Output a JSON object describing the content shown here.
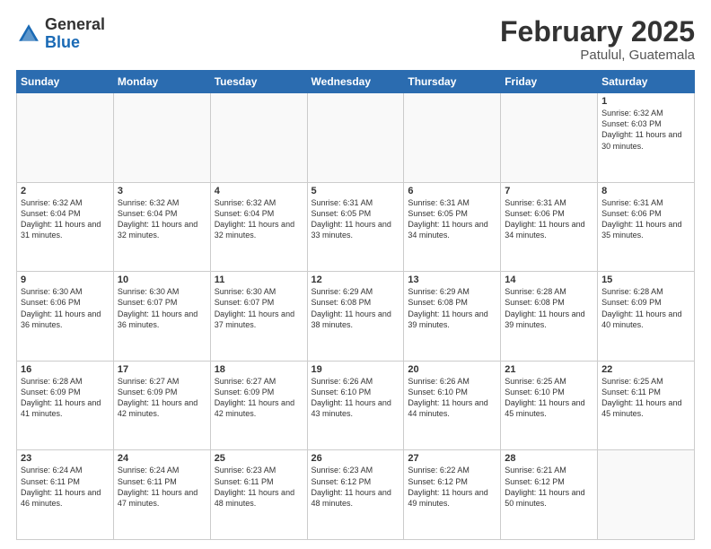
{
  "header": {
    "logo_general": "General",
    "logo_blue": "Blue",
    "month_title": "February 2025",
    "location": "Patulul, Guatemala"
  },
  "days_of_week": [
    "Sunday",
    "Monday",
    "Tuesday",
    "Wednesday",
    "Thursday",
    "Friday",
    "Saturday"
  ],
  "weeks": [
    [
      {
        "day": "",
        "info": ""
      },
      {
        "day": "",
        "info": ""
      },
      {
        "day": "",
        "info": ""
      },
      {
        "day": "",
        "info": ""
      },
      {
        "day": "",
        "info": ""
      },
      {
        "day": "",
        "info": ""
      },
      {
        "day": "1",
        "info": "Sunrise: 6:32 AM\nSunset: 6:03 PM\nDaylight: 11 hours and 30 minutes."
      }
    ],
    [
      {
        "day": "2",
        "info": "Sunrise: 6:32 AM\nSunset: 6:04 PM\nDaylight: 11 hours and 31 minutes."
      },
      {
        "day": "3",
        "info": "Sunrise: 6:32 AM\nSunset: 6:04 PM\nDaylight: 11 hours and 32 minutes."
      },
      {
        "day": "4",
        "info": "Sunrise: 6:32 AM\nSunset: 6:04 PM\nDaylight: 11 hours and 32 minutes."
      },
      {
        "day": "5",
        "info": "Sunrise: 6:31 AM\nSunset: 6:05 PM\nDaylight: 11 hours and 33 minutes."
      },
      {
        "day": "6",
        "info": "Sunrise: 6:31 AM\nSunset: 6:05 PM\nDaylight: 11 hours and 34 minutes."
      },
      {
        "day": "7",
        "info": "Sunrise: 6:31 AM\nSunset: 6:06 PM\nDaylight: 11 hours and 34 minutes."
      },
      {
        "day": "8",
        "info": "Sunrise: 6:31 AM\nSunset: 6:06 PM\nDaylight: 11 hours and 35 minutes."
      }
    ],
    [
      {
        "day": "9",
        "info": "Sunrise: 6:30 AM\nSunset: 6:06 PM\nDaylight: 11 hours and 36 minutes."
      },
      {
        "day": "10",
        "info": "Sunrise: 6:30 AM\nSunset: 6:07 PM\nDaylight: 11 hours and 36 minutes."
      },
      {
        "day": "11",
        "info": "Sunrise: 6:30 AM\nSunset: 6:07 PM\nDaylight: 11 hours and 37 minutes."
      },
      {
        "day": "12",
        "info": "Sunrise: 6:29 AM\nSunset: 6:08 PM\nDaylight: 11 hours and 38 minutes."
      },
      {
        "day": "13",
        "info": "Sunrise: 6:29 AM\nSunset: 6:08 PM\nDaylight: 11 hours and 39 minutes."
      },
      {
        "day": "14",
        "info": "Sunrise: 6:28 AM\nSunset: 6:08 PM\nDaylight: 11 hours and 39 minutes."
      },
      {
        "day": "15",
        "info": "Sunrise: 6:28 AM\nSunset: 6:09 PM\nDaylight: 11 hours and 40 minutes."
      }
    ],
    [
      {
        "day": "16",
        "info": "Sunrise: 6:28 AM\nSunset: 6:09 PM\nDaylight: 11 hours and 41 minutes."
      },
      {
        "day": "17",
        "info": "Sunrise: 6:27 AM\nSunset: 6:09 PM\nDaylight: 11 hours and 42 minutes."
      },
      {
        "day": "18",
        "info": "Sunrise: 6:27 AM\nSunset: 6:09 PM\nDaylight: 11 hours and 42 minutes."
      },
      {
        "day": "19",
        "info": "Sunrise: 6:26 AM\nSunset: 6:10 PM\nDaylight: 11 hours and 43 minutes."
      },
      {
        "day": "20",
        "info": "Sunrise: 6:26 AM\nSunset: 6:10 PM\nDaylight: 11 hours and 44 minutes."
      },
      {
        "day": "21",
        "info": "Sunrise: 6:25 AM\nSunset: 6:10 PM\nDaylight: 11 hours and 45 minutes."
      },
      {
        "day": "22",
        "info": "Sunrise: 6:25 AM\nSunset: 6:11 PM\nDaylight: 11 hours and 45 minutes."
      }
    ],
    [
      {
        "day": "23",
        "info": "Sunrise: 6:24 AM\nSunset: 6:11 PM\nDaylight: 11 hours and 46 minutes."
      },
      {
        "day": "24",
        "info": "Sunrise: 6:24 AM\nSunset: 6:11 PM\nDaylight: 11 hours and 47 minutes."
      },
      {
        "day": "25",
        "info": "Sunrise: 6:23 AM\nSunset: 6:11 PM\nDaylight: 11 hours and 48 minutes."
      },
      {
        "day": "26",
        "info": "Sunrise: 6:23 AM\nSunset: 6:12 PM\nDaylight: 11 hours and 48 minutes."
      },
      {
        "day": "27",
        "info": "Sunrise: 6:22 AM\nSunset: 6:12 PM\nDaylight: 11 hours and 49 minutes."
      },
      {
        "day": "28",
        "info": "Sunrise: 6:21 AM\nSunset: 6:12 PM\nDaylight: 11 hours and 50 minutes."
      },
      {
        "day": "",
        "info": ""
      }
    ]
  ]
}
